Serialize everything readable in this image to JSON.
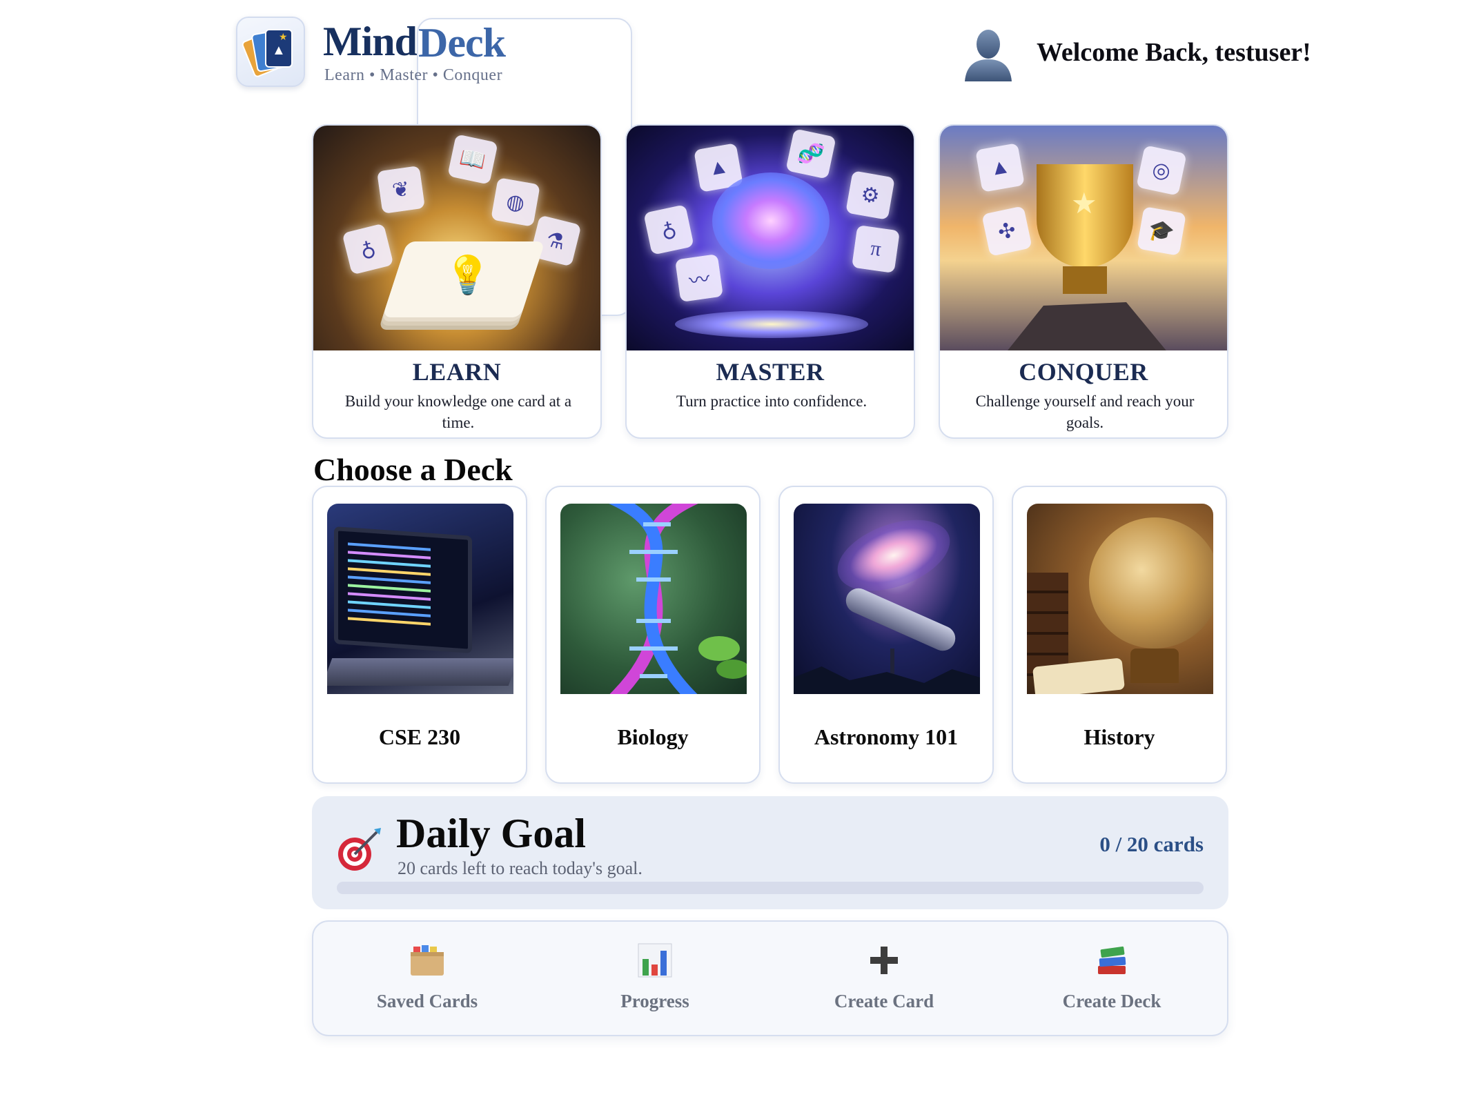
{
  "header": {
    "brand_part1": "Mind",
    "brand_part2": "Deck",
    "tagline": "Learn • Master • Conquer",
    "welcome": "Welcome Back, testuser!"
  },
  "features": [
    {
      "title": "LEARN",
      "description": "Build your knowledge one card at a time."
    },
    {
      "title": "MASTER",
      "description": "Turn practice into confidence."
    },
    {
      "title": "CONQUER",
      "description": "Challenge yourself and reach your goals."
    }
  ],
  "decks_section": {
    "title": "Choose a Deck",
    "decks": [
      {
        "name": "CSE 230"
      },
      {
        "name": "Biology"
      },
      {
        "name": "Astronomy 101"
      },
      {
        "name": "History"
      }
    ]
  },
  "daily_goal": {
    "title": "Daily Goal",
    "subtitle": "20 cards left to reach today's goal.",
    "count_text": "0 / 20 cards",
    "progress_fraction": 0
  },
  "nav": [
    {
      "label": "Saved Cards",
      "icon": "card-box-icon"
    },
    {
      "label": "Progress",
      "icon": "bar-chart-icon"
    },
    {
      "label": "Create Card",
      "icon": "plus-icon"
    },
    {
      "label": "Create Deck",
      "icon": "books-icon"
    }
  ],
  "colors": {
    "brand_dark": "#17305f",
    "brand_accent": "#3c66a8",
    "card_border": "#d6deef",
    "goal_background": "#e8edf6"
  }
}
